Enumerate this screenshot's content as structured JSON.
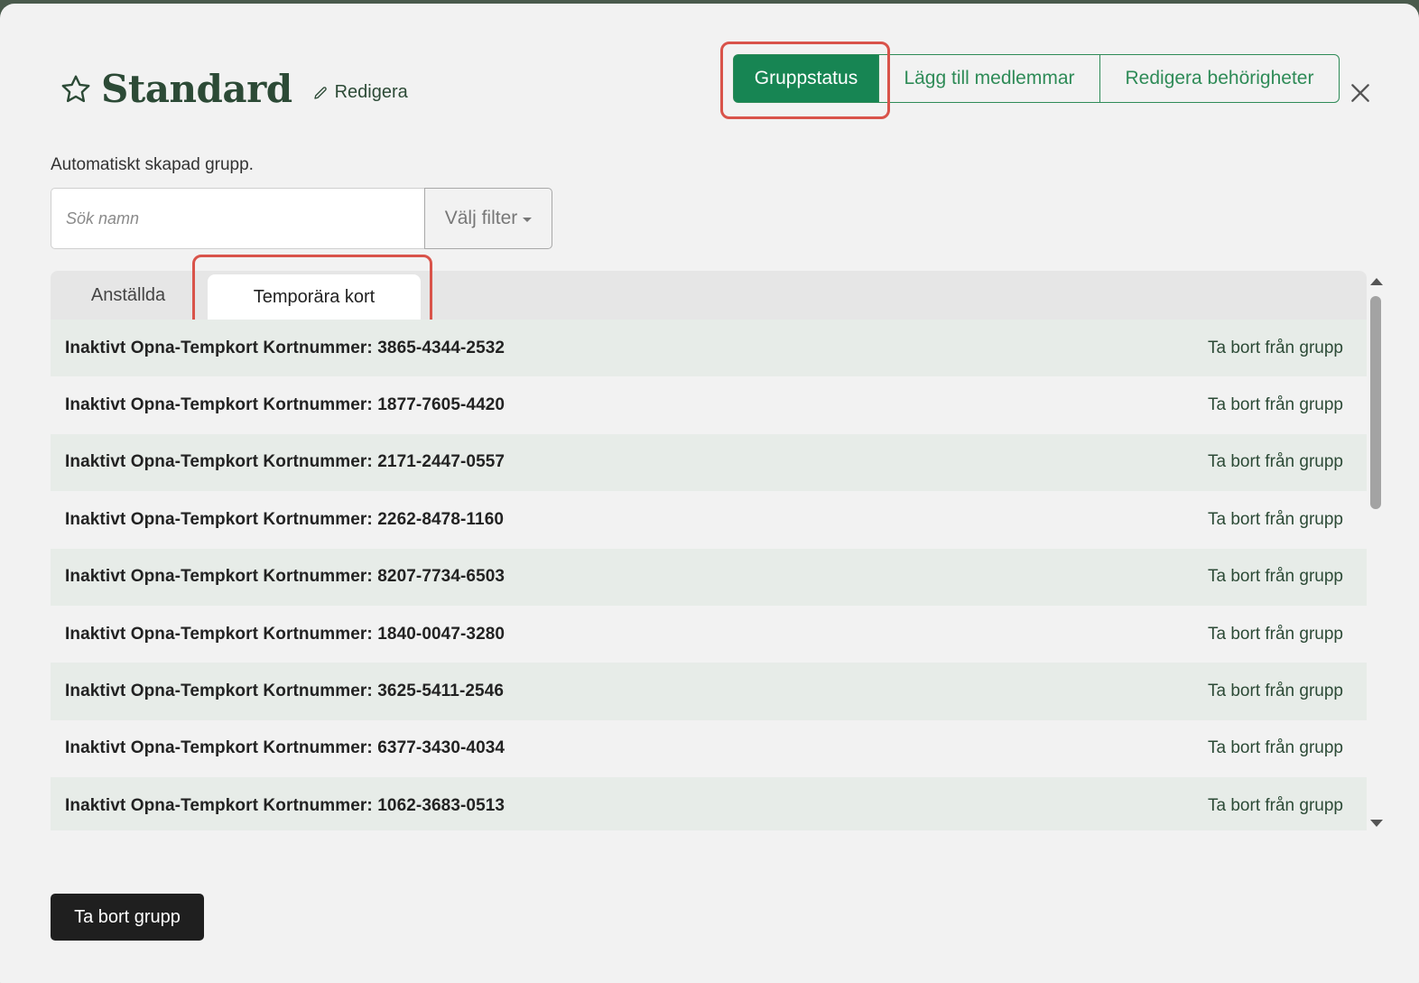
{
  "header": {
    "title": "Standard",
    "edit_label": "Redigera",
    "group_buttons": [
      "Gruppstatus",
      "Lägg till medlemmar",
      "Redigera behörigheter"
    ]
  },
  "description": "Automatiskt skapad grupp.",
  "search": {
    "placeholder": "Sök namn",
    "filter_label": "Välj filter"
  },
  "tabs": [
    "Anställda",
    "Temporära kort"
  ],
  "active_tab": "Temporära kort",
  "rows": [
    {
      "name": "Inaktivt Opna-Tempkort Kortnummer: 3865-4344-2532",
      "action": "Ta bort från grupp"
    },
    {
      "name": "Inaktivt Opna-Tempkort Kortnummer: 1877-7605-4420",
      "action": "Ta bort från grupp"
    },
    {
      "name": "Inaktivt Opna-Tempkort Kortnummer: 2171-2447-0557",
      "action": "Ta bort från grupp"
    },
    {
      "name": "Inaktivt Opna-Tempkort Kortnummer: 2262-8478-1160",
      "action": "Ta bort från grupp"
    },
    {
      "name": "Inaktivt Opna-Tempkort Kortnummer: 8207-7734-6503",
      "action": "Ta bort från grupp"
    },
    {
      "name": "Inaktivt Opna-Tempkort Kortnummer: 1840-0047-3280",
      "action": "Ta bort från grupp"
    },
    {
      "name": "Inaktivt Opna-Tempkort Kortnummer: 3625-5411-2546",
      "action": "Ta bort från grupp"
    },
    {
      "name": "Inaktivt Opna-Tempkort Kortnummer: 6377-3430-4034",
      "action": "Ta bort från grupp"
    },
    {
      "name": "Inaktivt Opna-Tempkort Kortnummer: 1062-3683-0513",
      "action": "Ta bort från grupp"
    }
  ],
  "delete_group_label": "Ta bort grupp",
  "colors": {
    "accent": "#178553",
    "title": "#2c4a36",
    "highlight": "#d9534a",
    "row_odd": "#e7ece8"
  },
  "icons": [
    "star-icon",
    "pencil-icon",
    "close-icon",
    "caret-down-icon",
    "scroll-up-icon",
    "scroll-down-icon"
  ]
}
